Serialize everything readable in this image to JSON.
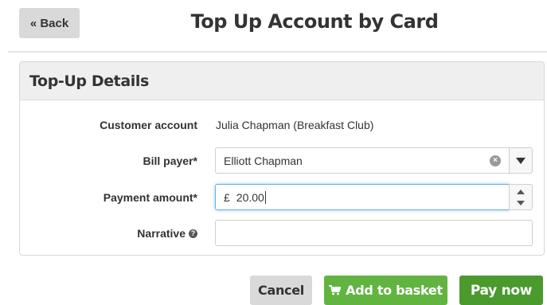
{
  "header": {
    "back_label": "« Back",
    "title": "Top Up Account by Card"
  },
  "panel": {
    "title": "Top-Up Details",
    "customer_account": {
      "label": "Customer account",
      "value": "Julia Chapman (Breakfast Club)"
    },
    "bill_payer": {
      "label": "Bill payer*",
      "value": "Elliott Chapman"
    },
    "payment_amount": {
      "label": "Payment amount*",
      "currency": "£",
      "value": "20.00"
    },
    "narrative": {
      "label": "Narrative",
      "value": ""
    }
  },
  "actions": {
    "cancel_label": "Cancel",
    "add_to_basket_label": "Add to basket",
    "pay_now_label": "Pay now"
  },
  "colors": {
    "accent_green": "#62b440",
    "pay_green": "#4a9a2d",
    "focus_blue": "#66afe9"
  },
  "icons": {
    "clear": "clear-icon",
    "dropdown": "chevron-down-icon",
    "help": "help-icon",
    "cart": "cart-icon"
  }
}
